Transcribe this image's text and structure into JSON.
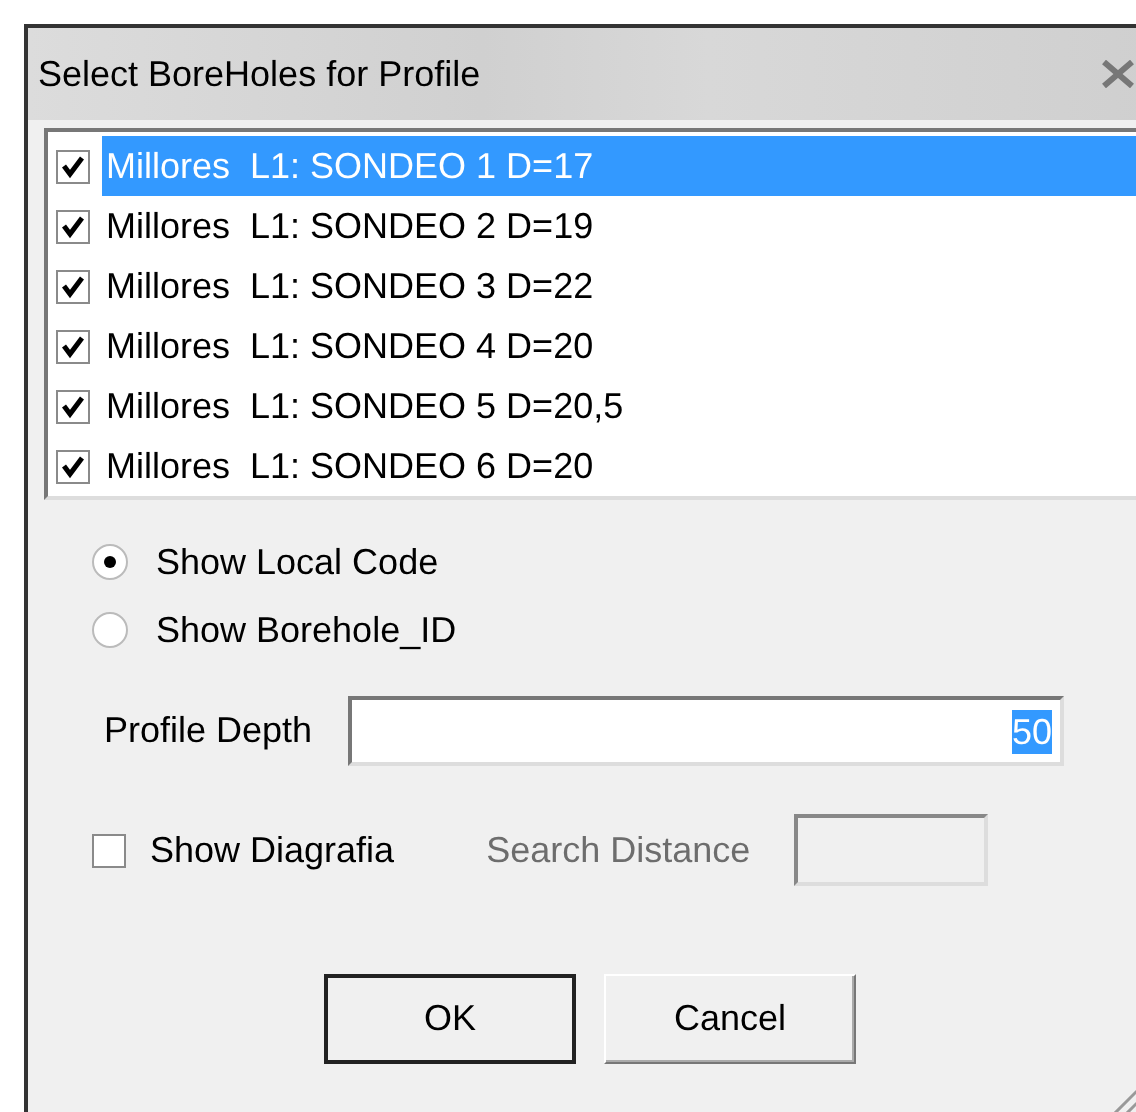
{
  "window": {
    "title": "Select BoreHoles for Profile"
  },
  "boreholes": [
    {
      "label": "Millores  L1: SONDEO 1 D=17",
      "checked": true,
      "selected": true
    },
    {
      "label": "Millores  L1: SONDEO 2 D=19",
      "checked": true,
      "selected": false
    },
    {
      "label": "Millores  L1: SONDEO 3 D=22",
      "checked": true,
      "selected": false
    },
    {
      "label": "Millores  L1: SONDEO 4 D=20",
      "checked": true,
      "selected": false
    },
    {
      "label": "Millores  L1: SONDEO 5 D=20,5",
      "checked": true,
      "selected": false
    },
    {
      "label": "Millores  L1: SONDEO 6 D=20",
      "checked": true,
      "selected": false
    }
  ],
  "code_options": [
    {
      "label": "Show Local Code",
      "selected": true
    },
    {
      "label": "Show Borehole_ID",
      "selected": false
    }
  ],
  "profile_depth": {
    "label": "Profile Depth",
    "value": "50"
  },
  "show_diagrafia": {
    "label": "Show Diagrafia",
    "checked": false
  },
  "search_distance": {
    "label": "Search Distance",
    "disabled": true
  },
  "buttons": [
    {
      "label": "OK",
      "default": true
    },
    {
      "label": "Cancel",
      "default": false
    }
  ]
}
